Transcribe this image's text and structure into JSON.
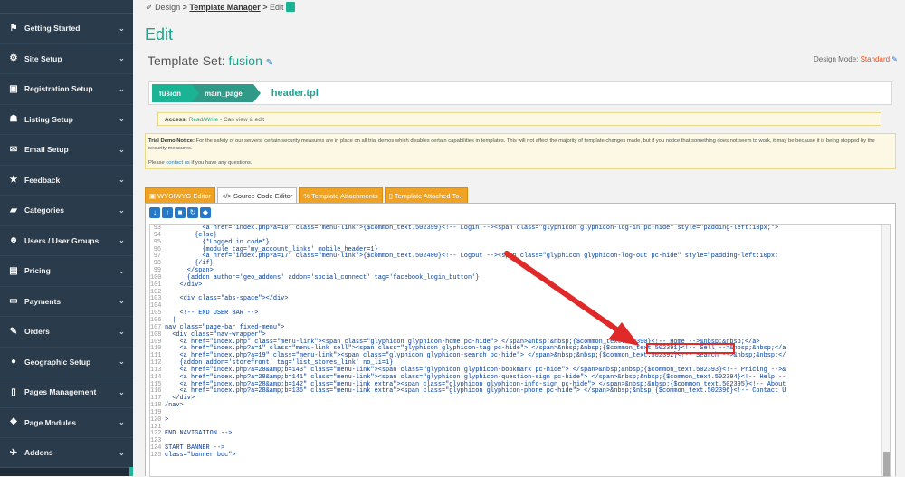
{
  "sidebar": {
    "items": [
      {
        "label": "Getting Started",
        "icon": "flag-icon",
        "glyph": "⚑"
      },
      {
        "label": "Site Setup",
        "icon": "gear-icon",
        "glyph": "⚙"
      },
      {
        "label": "Registration Setup",
        "icon": "registration-icon",
        "glyph": "▣"
      },
      {
        "label": "Listing Setup",
        "icon": "listing-icon",
        "glyph": "☗"
      },
      {
        "label": "Email Setup",
        "icon": "envelope-icon",
        "glyph": "✉"
      },
      {
        "label": "Feedback",
        "icon": "star-icon",
        "glyph": "★"
      },
      {
        "label": "Categories",
        "icon": "folder-icon",
        "glyph": "▰"
      },
      {
        "label": "Users / User Groups",
        "icon": "users-icon",
        "glyph": "☻"
      },
      {
        "label": "Pricing",
        "icon": "money-icon",
        "glyph": "▤"
      },
      {
        "label": "Payments",
        "icon": "credit-card-icon",
        "glyph": "▭"
      },
      {
        "label": "Orders",
        "icon": "edit-icon",
        "glyph": "✎"
      },
      {
        "label": "Geographic Setup",
        "icon": "globe-icon",
        "glyph": "●"
      },
      {
        "label": "Pages Management",
        "icon": "page-icon",
        "glyph": "▯"
      },
      {
        "label": "Page Modules",
        "icon": "modules-icon",
        "glyph": "❖"
      },
      {
        "label": "Addons",
        "icon": "addons-icon",
        "glyph": "✈"
      }
    ]
  },
  "breadcrumb": {
    "design": "Design",
    "sep1": ">",
    "manager": "Template Manager",
    "sep2": ">",
    "edit": "Edit"
  },
  "page_title": "Edit",
  "template_set": {
    "label": "Template Set:",
    "value": "fusion"
  },
  "design_mode": {
    "label": "Design Mode:",
    "value": "Standard"
  },
  "path": {
    "seg1": "fusion",
    "seg2": "main_page",
    "file": "header.tpl"
  },
  "access": {
    "label": "Access:",
    "value": "Read/Write",
    "desc": "- Can view & edit"
  },
  "notice": {
    "title": "Trial Demo Notice:",
    "body": "For the safety of our servers, certain security measures are in place on all trial demos which disables certain capabilities in templates. This will not affect the majority of template changes made, but if you notice that something does not seem to work, it may be because it is being stopped by the security measures.",
    "pre": "Please",
    "link": "contact us",
    "post": "if you have any questions."
  },
  "tabs": [
    {
      "label": "WYSIWYG Editor",
      "icon": "edit-icon"
    },
    {
      "label": "</> Source Code Editor",
      "icon": "code-icon"
    },
    {
      "label": "% Template Attachments",
      "icon": "attachment-icon"
    },
    {
      "label": "Template Attached To..",
      "icon": "file-icon"
    }
  ],
  "code_lines": [
    {
      "n": "93",
      "t": "          <a href=\"index.php?a=10\" class=\"menu-link\">{$common_text.502399}<!-- Login --><span class=\"glyphicon glyphicon-log-in pc-hide\" style=\"padding-left:10px;\">"
    },
    {
      "n": "94",
      "t": "        {else}"
    },
    {
      "n": "95",
      "t": "          {*Logged in code*}"
    },
    {
      "n": "96",
      "t": "          {module tag='my_account_links' mobile_header=1}"
    },
    {
      "n": "97",
      "t": "          <a href=\"index.php?a=17\" class=\"menu-link\">{$common_text.502400}<!-- Logout --><span class=\"glyphicon glyphicon-log-out pc-hide\" style=\"padding-left:10px;"
    },
    {
      "n": "98",
      "t": "        {/if}"
    },
    {
      "n": "99",
      "t": "      </span>"
    },
    {
      "n": "100",
      "t": "      {addon author='geo_addons' addon='social_connect' tag='facebook_login_button'}"
    },
    {
      "n": "101",
      "t": "    </div>"
    },
    {
      "n": "102",
      "t": ""
    },
    {
      "n": "103",
      "t": "    <div class=\"abs-space\"></div>"
    },
    {
      "n": "104",
      "t": ""
    },
    {
      "n": "105",
      "t": "    <!-- END USER BAR -->"
    },
    {
      "n": "106",
      "t": "  |"
    },
    {
      "n": "107",
      "t": "nav class=\"page-bar fixed-menu\">"
    },
    {
      "n": "108",
      "t": "  <div class=\"nav-wrapper\">"
    },
    {
      "n": "109",
      "t": "    <a href=\"index.php\" class=\"menu-link\"><span class=\"glyphicon glyphicon-home pc-hide\"> </span>&nbsp;&nbsp;{$common_text.502390}<!-- Home -->&nbsp;&nbsp;</a>"
    },
    {
      "n": "110",
      "t": "    <a href=\"index.php?a=1\" class=\"menu-link sell\"><span class=\"glyphicon glyphicon-tag pc-hide\"> </span>&nbsp;&nbsp;{$common_text.502391}<!-- Sell -->&nbsp;&nbsp;</a"
    },
    {
      "n": "111",
      "t": "    <a href=\"index.php?a=19\" class=\"menu-link\"><span class=\"glyphicon glyphicon-search pc-hide\"> </span>&nbsp;&nbsp;{$common_text.502392}<!-- Search -->&nbsp;&nbsp;</"
    },
    {
      "n": "112",
      "t": "    {addon addon='storefront' tag='list_stores_link' no_li=1}"
    },
    {
      "n": "113",
      "t": "    <a href=\"index.php?a=28&amp;b=143\" class=\"menu-link\"><span class=\"glyphicon glyphicon-bookmark pc-hide\"> </span>&nbsp;&nbsp;{$common_text.502393}<!-- Pricing -->&"
    },
    {
      "n": "114",
      "t": "    <a href=\"index.php?a=28&amp;b=141\" class=\"menu-link\"><span class=\"glyphicon glyphicon-question-sign pc-hide\"> </span>&nbsp;&nbsp;{$common_text.502394}<!-- Help --"
    },
    {
      "n": "115",
      "t": "    <a href=\"index.php?a=28&amp;b=142\" class=\"menu-link extra\"><span class=\"glyphicon glyphicon-info-sign pc-hide\"> </span>&nbsp;&nbsp;{$common_text.502395}<!-- About"
    },
    {
      "n": "116",
      "t": "    <a href=\"index.php?a=28&amp;b=136\" class=\"menu-link extra\"><span class=\"glyphicon glyphicon-phone pc-hide\"> </span>&nbsp;&nbsp;{$common_text.502396}<!-- Contact U"
    },
    {
      "n": "117",
      "t": "  </div>"
    },
    {
      "n": "118",
      "t": "/nav>"
    },
    {
      "n": "119",
      "t": ""
    },
    {
      "n": "120",
      "t": ">"
    },
    {
      "n": "121",
      "t": ""
    },
    {
      "n": "122",
      "t": "END NAVIGATION -->"
    },
    {
      "n": "123",
      "t": ""
    },
    {
      "n": "124",
      "t": "START BANNER -->"
    },
    {
      "n": "125",
      "t": "class=\"banner bdc\">"
    }
  ],
  "colors": {
    "accent": "#1aa58f",
    "sidebar": "#2a3b4c",
    "tab_orange": "#f0a223",
    "annotation": "#e02a2a"
  }
}
